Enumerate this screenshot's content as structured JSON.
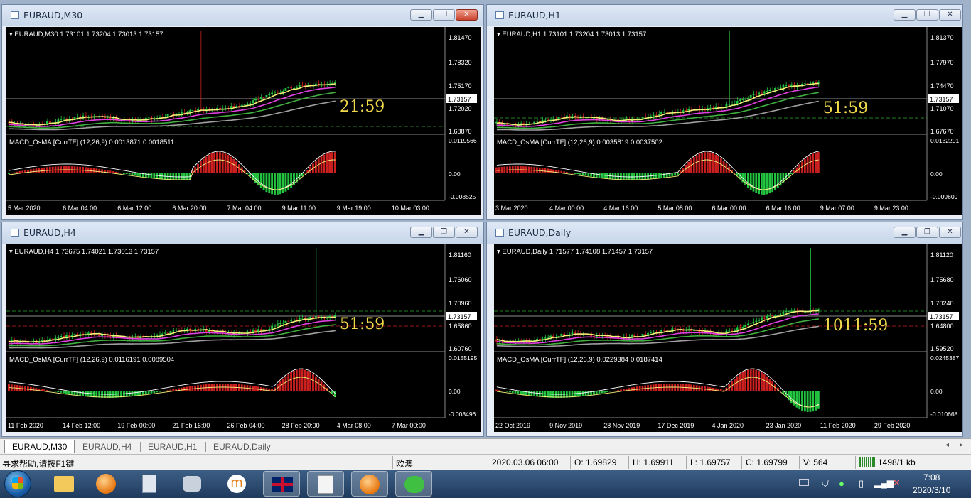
{
  "windows": [
    {
      "id": "m30",
      "title": "EURAUD,M30",
      "info": "EURAUD,M30  1.73101 1.73204 1.73013 1.73157",
      "price_labels": [
        "1.81470",
        "1.78320",
        "1.75170",
        "1.72020",
        "1.68870"
      ],
      "current_price": "1.73157",
      "countdown": "21:59",
      "macd_label": "MACD_OsMA [CurrTF] (12,26,9) 0.0013871 0.0018511",
      "macd_labels": [
        "0.0119566",
        "0.00",
        "-0.008525"
      ],
      "time_labels": [
        "5 Mar 2020",
        "6 Mar 04:00",
        "6 Mar 12:00",
        "6 Mar 20:00",
        "7 Mar 04:00",
        "9 Mar 11:00",
        "9 Mar 19:00",
        "10 Mar 03:00"
      ]
    },
    {
      "id": "h1",
      "title": "EURAUD,H1",
      "info": "EURAUD,H1  1.73101 1.73204 1.73013 1.73157",
      "price_labels": [
        "1.81370",
        "1.77970",
        "1.74470",
        "1.71070",
        "1.67670"
      ],
      "current_price": "1.73157",
      "countdown": "51:59",
      "macd_label": "MACD_OsMA [CurrTF] (12,26,9) 0.0035819 0.0037502",
      "macd_labels": [
        "0.0132201",
        "0.00",
        "-0.009609"
      ],
      "time_labels": [
        "3 Mar 2020",
        "4 Mar 00:00",
        "4 Mar 16:00",
        "5 Mar 08:00",
        "6 Mar 00:00",
        "6 Mar 16:00",
        "9 Mar 07:00",
        "9 Mar 23:00"
      ]
    },
    {
      "id": "h4",
      "title": "EURAUD,H4",
      "info": "EURAUD,H4  1.73675 1.74021 1.73013 1.73157",
      "price_labels": [
        "1.81160",
        "1.76060",
        "1.70960",
        "1.65860",
        "1.60760"
      ],
      "current_price": "1.73157",
      "countdown": "51:59",
      "macd_label": "MACD_OsMA [CurrTF] (12,26,9) 0.0116191 0.0089504",
      "macd_labels": [
        "0.0155195",
        "0.00",
        "-0.008496"
      ],
      "time_labels": [
        "11 Feb 2020",
        "14 Feb 12:00",
        "19 Feb 00:00",
        "21 Feb 16:00",
        "26 Feb 04:00",
        "28 Feb 20:00",
        "4 Mar 08:00",
        "7 Mar 00:00"
      ]
    },
    {
      "id": "d1",
      "title": "EURAUD,Daily",
      "info": "EURAUD,Daily  1.71577 1.74108 1.71457 1.73157",
      "price_labels": [
        "1.81120",
        "1.75680",
        "1.70240",
        "1.64800",
        "1.59520"
      ],
      "current_price": "1.73157",
      "countdown": "1011:59",
      "macd_label": "MACD_OsMA [CurrTF] (12,26,9) 0.0229384 0.0187414",
      "macd_labels": [
        "0.0245387",
        "0.00",
        "-0.010668"
      ],
      "time_labels": [
        "22 Oct 2019",
        "9 Nov 2019",
        "28 Nov 2019",
        "17 Dec 2019",
        "4 Jan 2020",
        "23 Jan 2020",
        "11 Feb 2020",
        "29 Feb 2020"
      ]
    }
  ],
  "tabs": [
    "EURAUD,M30",
    "EURAUD,H4",
    "EURAUD,H1",
    "EURAUD,Daily"
  ],
  "status": {
    "help": "寻求帮助,请按F1键",
    "profile": "欧澳",
    "datetime": "2020.03.06 06:00",
    "open": "O: 1.69829",
    "high": "H: 1.69911",
    "low": "L: 1.69757",
    "close": "C: 1.69799",
    "volume": "V: 564",
    "traffic": "1498/1 kb"
  },
  "taskbar": {
    "time": "7:08",
    "date": "2020/3/10"
  },
  "colors": {
    "countdown": "#f0d94a",
    "bull": "#22c440",
    "bear": "#cc2020",
    "ma_yellow": "#f5f07a",
    "ma_magenta": "#e040e0",
    "ma_green": "#40b040",
    "ma_gray": "#a0a0a0"
  }
}
